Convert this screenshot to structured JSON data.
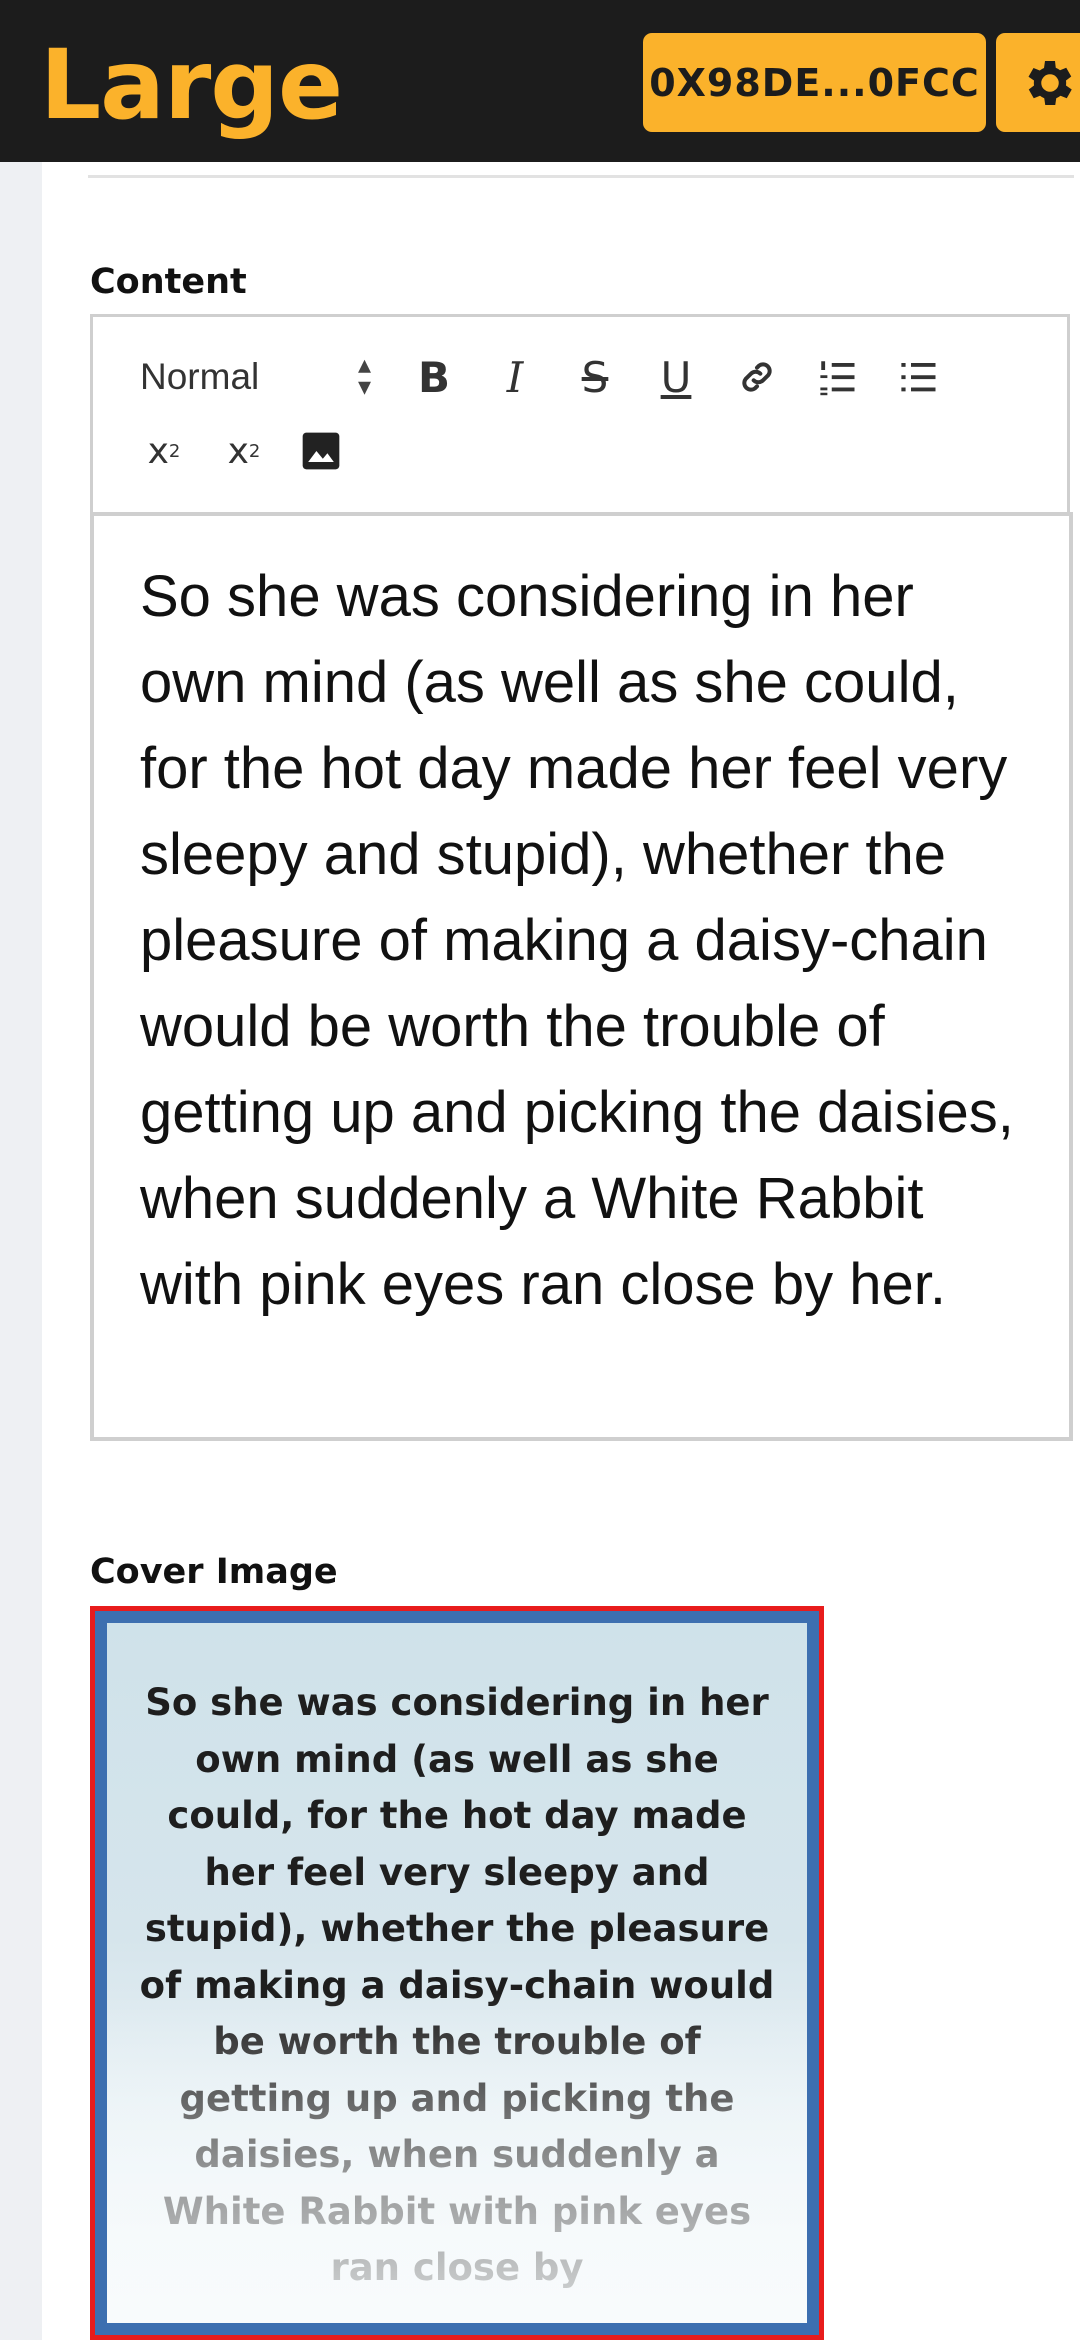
{
  "header": {
    "brand": "Large",
    "wallet_address": "0X98DE...0FCC",
    "settings_icon": "gear-icon",
    "accent_color": "#fbb22b",
    "background_color": "#1c1c1c"
  },
  "form": {
    "content_label": "Content",
    "cover_label": "Cover Image"
  },
  "toolbar": {
    "format_select": "Normal",
    "bold": "B",
    "italic": "I",
    "strike": "S",
    "underline": "U",
    "subscript_base": "x",
    "subscript_mark": "2",
    "superscript_base": "x",
    "superscript_mark": "2",
    "icons": [
      "link-icon",
      "ordered-list-icon",
      "bullet-list-icon",
      "image-icon"
    ]
  },
  "editor": {
    "text": "So she was considering in her own mind (as well as she could, for the hot day made her feel very sleepy and stupid), whether the pleasure of making a daisy-chain would be worth the trouble of getting up and picking the daisies, when suddenly a White Rabbit with pink eyes ran close by her."
  },
  "cover": {
    "text": "So she was considering in her own mind (as well as she could, for the hot day made her feel very sleepy and stupid), whether the pleasure of making a daisy-chain would be worth the trouble of getting up and picking the daisies, when suddenly a White Rabbit with pink eyes ran close by",
    "border_color": "#e81c1c"
  }
}
